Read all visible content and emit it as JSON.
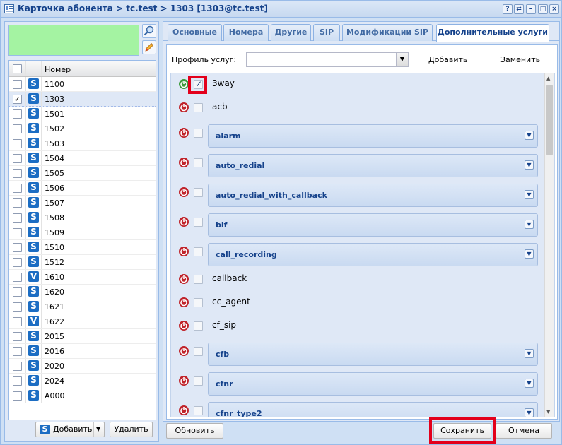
{
  "window": {
    "title": "Карточка абонента > tc.test > 1303 [1303@tc.test]",
    "tool_buttons": [
      "?",
      "⇄",
      "–",
      "□",
      "×"
    ]
  },
  "left": {
    "grid_header": "Номер",
    "rows": [
      {
        "number": "1100",
        "type": "S",
        "checked": false
      },
      {
        "number": "1303",
        "type": "S",
        "checked": true
      },
      {
        "number": "1501",
        "type": "S",
        "checked": false
      },
      {
        "number": "1502",
        "type": "S",
        "checked": false
      },
      {
        "number": "1503",
        "type": "S",
        "checked": false
      },
      {
        "number": "1504",
        "type": "S",
        "checked": false
      },
      {
        "number": "1505",
        "type": "S",
        "checked": false
      },
      {
        "number": "1506",
        "type": "S",
        "checked": false
      },
      {
        "number": "1507",
        "type": "S",
        "checked": false
      },
      {
        "number": "1508",
        "type": "S",
        "checked": false
      },
      {
        "number": "1509",
        "type": "S",
        "checked": false
      },
      {
        "number": "1510",
        "type": "S",
        "checked": false
      },
      {
        "number": "1512",
        "type": "S",
        "checked": false
      },
      {
        "number": "1610",
        "type": "V",
        "checked": false
      },
      {
        "number": "1620",
        "type": "S",
        "checked": false
      },
      {
        "number": "1621",
        "type": "S",
        "checked": false
      },
      {
        "number": "1622",
        "type": "V",
        "checked": false
      },
      {
        "number": "2015",
        "type": "S",
        "checked": false
      },
      {
        "number": "2016",
        "type": "S",
        "checked": false
      },
      {
        "number": "2020",
        "type": "S",
        "checked": false
      },
      {
        "number": "2024",
        "type": "S",
        "checked": false
      },
      {
        "number": "A000",
        "type": "S",
        "checked": false
      }
    ],
    "add_label": "Добавить",
    "delete_label": "Удалить",
    "icons": {
      "search": "search-icon",
      "edit": "pencil-icon"
    }
  },
  "tabs": [
    {
      "label": "Основные",
      "active": false
    },
    {
      "label": "Номера",
      "active": false
    },
    {
      "label": "Другие",
      "active": false
    },
    {
      "label": "SIP",
      "active": false
    },
    {
      "label": "Модификации SIP",
      "active": false
    },
    {
      "label": "Дополнительные услуги",
      "active": true
    }
  ],
  "services_tab": {
    "profile_label": "Профиль услуг:",
    "profile_value": "",
    "add_label": "Добавить",
    "replace_label": "Заменить",
    "services": [
      {
        "name": "3way",
        "enabled": true,
        "checked": true,
        "group": false
      },
      {
        "name": "acb",
        "enabled": false,
        "checked": false,
        "group": false
      },
      {
        "name": "alarm",
        "enabled": false,
        "checked": false,
        "group": true
      },
      {
        "name": "auto_redial",
        "enabled": false,
        "checked": false,
        "group": true
      },
      {
        "name": "auto_redial_with_callback",
        "enabled": false,
        "checked": false,
        "group": true
      },
      {
        "name": "blf",
        "enabled": false,
        "checked": false,
        "group": true
      },
      {
        "name": "call_recording",
        "enabled": false,
        "checked": false,
        "group": true
      },
      {
        "name": "callback",
        "enabled": false,
        "checked": false,
        "group": false
      },
      {
        "name": "cc_agent",
        "enabled": false,
        "checked": false,
        "group": false
      },
      {
        "name": "cf_sip",
        "enabled": false,
        "checked": false,
        "group": false
      },
      {
        "name": "cfb",
        "enabled": false,
        "checked": false,
        "group": true
      },
      {
        "name": "cfnr",
        "enabled": false,
        "checked": false,
        "group": true
      },
      {
        "name": "cfnr_type2",
        "enabled": false,
        "checked": false,
        "group": true
      }
    ]
  },
  "footer": {
    "refresh_label": "Обновить",
    "save_label": "Сохранить",
    "cancel_label": "Отмена"
  },
  "colors": {
    "accent": "#15428b",
    "highlight": "#e3001b",
    "enabled": "#3c9a3c",
    "disabled": "#c0242b"
  }
}
